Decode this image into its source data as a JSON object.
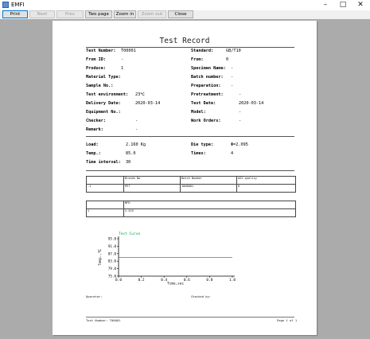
{
  "window": {
    "title": "EMFI"
  },
  "toolbar": {
    "print": "Print",
    "next": "Next",
    "prev": "Prev",
    "two_page": "Two page",
    "zoom_in": "Zoom in",
    "zoom_out": "Zoom out",
    "close": "Close"
  },
  "report": {
    "title": "Test Record",
    "fields": [
      {
        "label": "Test Number:",
        "value": "T00001"
      },
      {
        "label": "Standard:",
        "value": "GB/T10"
      },
      {
        "label": "From ID:",
        "value": "-"
      },
      {
        "label": "From:",
        "value": "0"
      },
      {
        "label": "Produce:",
        "value": "1"
      },
      {
        "label": "Specimen Name:",
        "value": "-"
      },
      {
        "label": "Material Type:",
        "value": ""
      },
      {
        "label": "Batch number:",
        "value": "-"
      },
      {
        "label": "Sample No.:",
        "value": ""
      },
      {
        "label": "Preparation:",
        "value": "-"
      },
      {
        "label": "Test environment:",
        "value": "23℃"
      },
      {
        "label": "Pretreatment:",
        "value": "-"
      },
      {
        "label": "Delivery Date:",
        "value": "2020-03-14"
      },
      {
        "label": "Test Date:",
        "value": "2020-03-14"
      },
      {
        "label": "Equipment No.:",
        "value": ""
      },
      {
        "label": "Model:",
        "value": "-"
      },
      {
        "label": "Checker:",
        "value": "-"
      },
      {
        "label": "Work Orders:",
        "value": "-"
      },
      {
        "label": "Remark:",
        "value": "-"
      }
    ],
    "params": [
      {
        "label": "Load:",
        "value": "2.160 Kg"
      },
      {
        "label": "Die type:",
        "value": "Φ=2.095"
      },
      {
        "label": "Temp.:",
        "value": "85.0"
      },
      {
        "label": "Times:",
        "value": "4"
      },
      {
        "label": "Time interval:",
        "value": "30"
      }
    ],
    "table1": {
      "headers": [
        "",
        "Brands No",
        "Batch Number",
        "ASS quality"
      ],
      "row": [
        "-1",
        "PET",
        "1008001",
        "0"
      ]
    },
    "table2": {
      "headers": [
        "",
        "MFR"
      ],
      "row": [
        "1",
        "2.515"
      ]
    },
    "signatures": {
      "operator": "Operator:",
      "checked_by": "Checked by:"
    },
    "footer": {
      "left": "Test Number: T00001",
      "right": "Page 1 of 1"
    }
  },
  "chart_data": {
    "type": "line",
    "title": "Test Curve",
    "xlabel": "Time,sec",
    "ylabel": "Temp.,℃",
    "xlim": [
      0.0,
      1.0
    ],
    "ylim": [
      75.0,
      95.0
    ],
    "xticks": [
      "0.0",
      "0.2",
      "0.4",
      "0.6",
      "0.8",
      "1.0"
    ],
    "yticks": [
      "75.0",
      "79.0",
      "83.0",
      "87.0",
      "91.0",
      "95.0"
    ],
    "series": [
      {
        "x": [
          0.0,
          1.0
        ],
        "y": [
          85.0,
          85.0
        ],
        "color": "#00b050"
      }
    ]
  }
}
